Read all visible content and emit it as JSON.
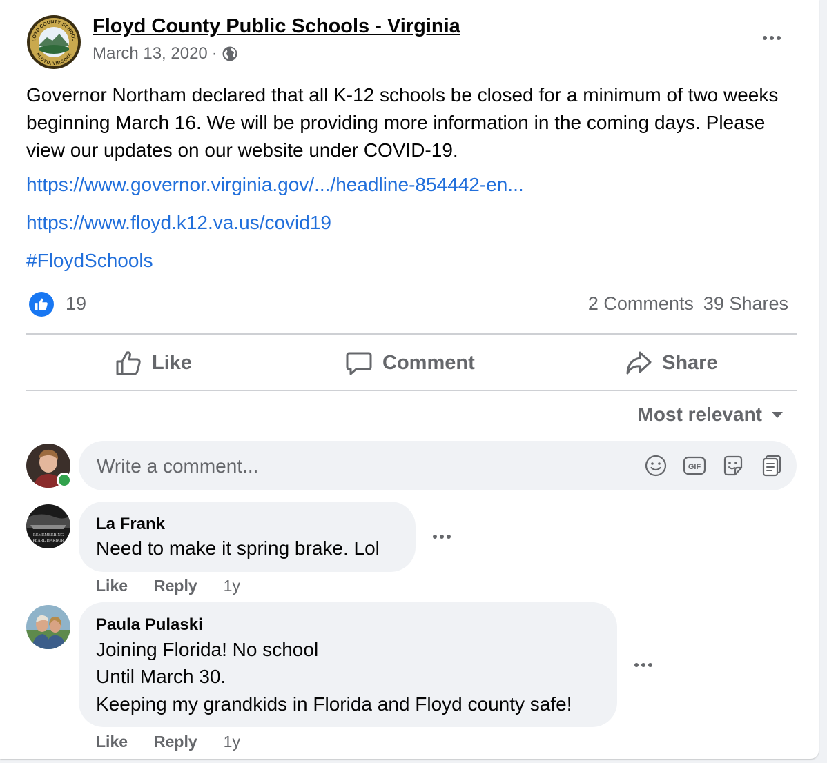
{
  "post": {
    "page_name": "Floyd County Public Schools - Virginia",
    "date": "March 13, 2020",
    "meta_separator": "·",
    "audience_icon": "globe-icon",
    "body": "Governor Northam declared that all K-12 schools be closed for a minimum of two weeks beginning March 16. We will be providing more information in the coming days. Please view our updates on our website under COVID-19.",
    "links": [
      "https://www.governor.virginia.gov/.../headline-854442-en...",
      "https://www.floyd.k12.va.us/covid19"
    ],
    "hashtag": "#FloydSchools",
    "reaction_count": "19",
    "comments_count": "2 Comments",
    "shares_count": "39 Shares"
  },
  "logo": {
    "top_text": "FLOYD COUNTY SCHOOLS",
    "bottom_text": "FLOYD, VIRGINIA"
  },
  "actions": {
    "like": "Like",
    "comment": "Comment",
    "share": "Share"
  },
  "sort": {
    "label": "Most relevant"
  },
  "composer": {
    "placeholder": "Write a comment...",
    "icons": [
      "emoji-icon",
      "gif-icon",
      "sticker-icon",
      "avatar-sticker-icon"
    ],
    "gif_label": "GIF"
  },
  "comments": [
    {
      "author": "La Frank",
      "lines": [
        "Need to make it spring brake. Lol"
      ],
      "avatar_text": [
        "REMEMBERING",
        "PEARL HARBOR"
      ],
      "like": "Like",
      "reply": "Reply",
      "time": "1y"
    },
    {
      "author": "Paula Pulaski",
      "lines": [
        "Joining Florida! No school",
        "Until March 30.",
        "Keeping my grandkids in Florida and Floyd county safe!"
      ],
      "like": "Like",
      "reply": "Reply",
      "time": "1y"
    }
  ],
  "colors": {
    "link": "#216fdb",
    "secondary_text": "#65676b",
    "like_blue": "#1877f2",
    "online_green": "#31a24c",
    "bubble_bg": "#f0f2f5"
  }
}
